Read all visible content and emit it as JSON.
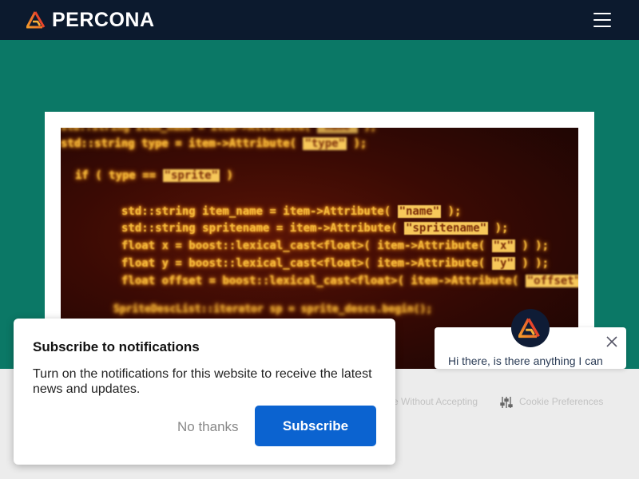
{
  "navbar": {
    "logo_text": "PERCONA",
    "logo_icon": "percona-logo-icon",
    "menu_icon": "hamburger-menu-icon"
  },
  "colors": {
    "navbar_bg": "#0c1a2e",
    "page_bg": "#0b7866",
    "subscribe_bg": "#0b63d0",
    "code_glow": "#f4b93a"
  },
  "hero": {
    "code_lines": [
      {
        "pre": "std::string item_name = item->Attribute( ",
        "hl": "\"name\"",
        "post": " );"
      },
      {
        "pre": "std::string type = item->Attribute( ",
        "hl": "\"type\"",
        "post": " );"
      },
      {
        "pre": "if ( type == ",
        "hl": "\"sprite\"",
        "post": " )"
      },
      {
        "pre": "std::string item_name = item->Attribute( ",
        "hl": "\"name\"",
        "post": " );"
      },
      {
        "pre": "std::string spritename = item->Attribute( ",
        "hl": "\"spritename\"",
        "post": " );"
      },
      {
        "pre": "float x = boost::lexical_cast<float>( item->Attribute( ",
        "hl": "\"x\"",
        "post": " ) );"
      },
      {
        "pre": "float y = boost::lexical_cast<float>( item->Attribute( ",
        "hl": "\"y\"",
        "post": " ) );"
      },
      {
        "pre": "float offset = boost::lexical_cast<float>( item->Attribute( ",
        "hl": "\"offset\"",
        "post": " ) );"
      },
      {
        "pre": "SpriteDescList::iterator sp = sprite_descs.begin();",
        "hl": "",
        "post": ""
      }
    ]
  },
  "cookie_bar": {
    "decline_label": "e Without Accepting",
    "preferences_label": "Cookie Preferences",
    "preferences_icon": "sliders-icon"
  },
  "notification": {
    "title": "Subscribe to notifications",
    "body": "Turn on the notifications for this website to receive the latest news and updates.",
    "no_thanks": "No thanks",
    "subscribe": "Subscribe"
  },
  "chat": {
    "message": "Hi there, is there anything I can",
    "close_icon": "close-icon",
    "avatar_icon": "percona-logo-icon"
  }
}
